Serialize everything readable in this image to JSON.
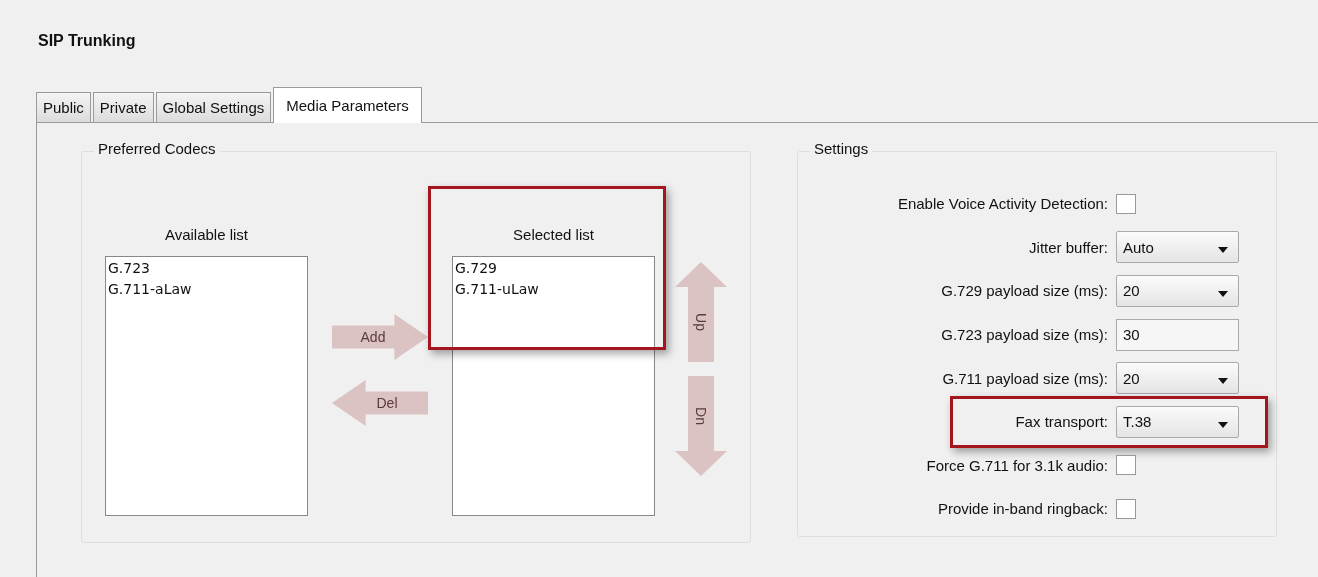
{
  "title": "SIP Trunking",
  "tabs": [
    {
      "label": "Public",
      "selected": false
    },
    {
      "label": "Private",
      "selected": false
    },
    {
      "label": "Global Settings",
      "selected": false
    },
    {
      "label": "Media Parameters",
      "selected": true
    }
  ],
  "codecs": {
    "title": "Preferred Codecs",
    "available": {
      "label": "Available list",
      "items": [
        "G.723",
        "G.711-aLaw"
      ],
      "highlighted": false
    },
    "selected": {
      "label": "Selected list",
      "items": [
        "G.729",
        "G.711-uLaw"
      ],
      "highlighted": true
    },
    "add_button": {
      "label": "Add",
      "disabled": true
    },
    "del_button": {
      "label": "Del",
      "disabled": true
    },
    "up_button": {
      "label": "Up",
      "disabled": true
    },
    "down_button": {
      "label": "Dn",
      "disabled": true
    }
  },
  "settings": {
    "title": "Settings",
    "rows": [
      {
        "kind": "checkbox",
        "label": "Enable Voice Activity Detection:",
        "checked": false,
        "highlighted": false
      },
      {
        "kind": "dropdown",
        "label": "Jitter buffer:",
        "value": "Auto",
        "highlighted": false
      },
      {
        "kind": "dropdown",
        "label": "G.729 payload size (ms):",
        "value": "20",
        "highlighted": false
      },
      {
        "kind": "text",
        "label": "G.723 payload size (ms):",
        "value": "30",
        "highlighted": false
      },
      {
        "kind": "dropdown",
        "label": "G.711 payload size (ms):",
        "value": "20",
        "highlighted": false
      },
      {
        "kind": "dropdown",
        "label": "Fax transport:",
        "value": "T.38",
        "highlighted": true
      },
      {
        "kind": "checkbox",
        "label": "Force G.711 for 3.1k audio:",
        "checked": false,
        "highlighted": false
      },
      {
        "kind": "checkbox",
        "label": "Provide in-band ringback:",
        "checked": false,
        "highlighted": false
      }
    ]
  }
}
